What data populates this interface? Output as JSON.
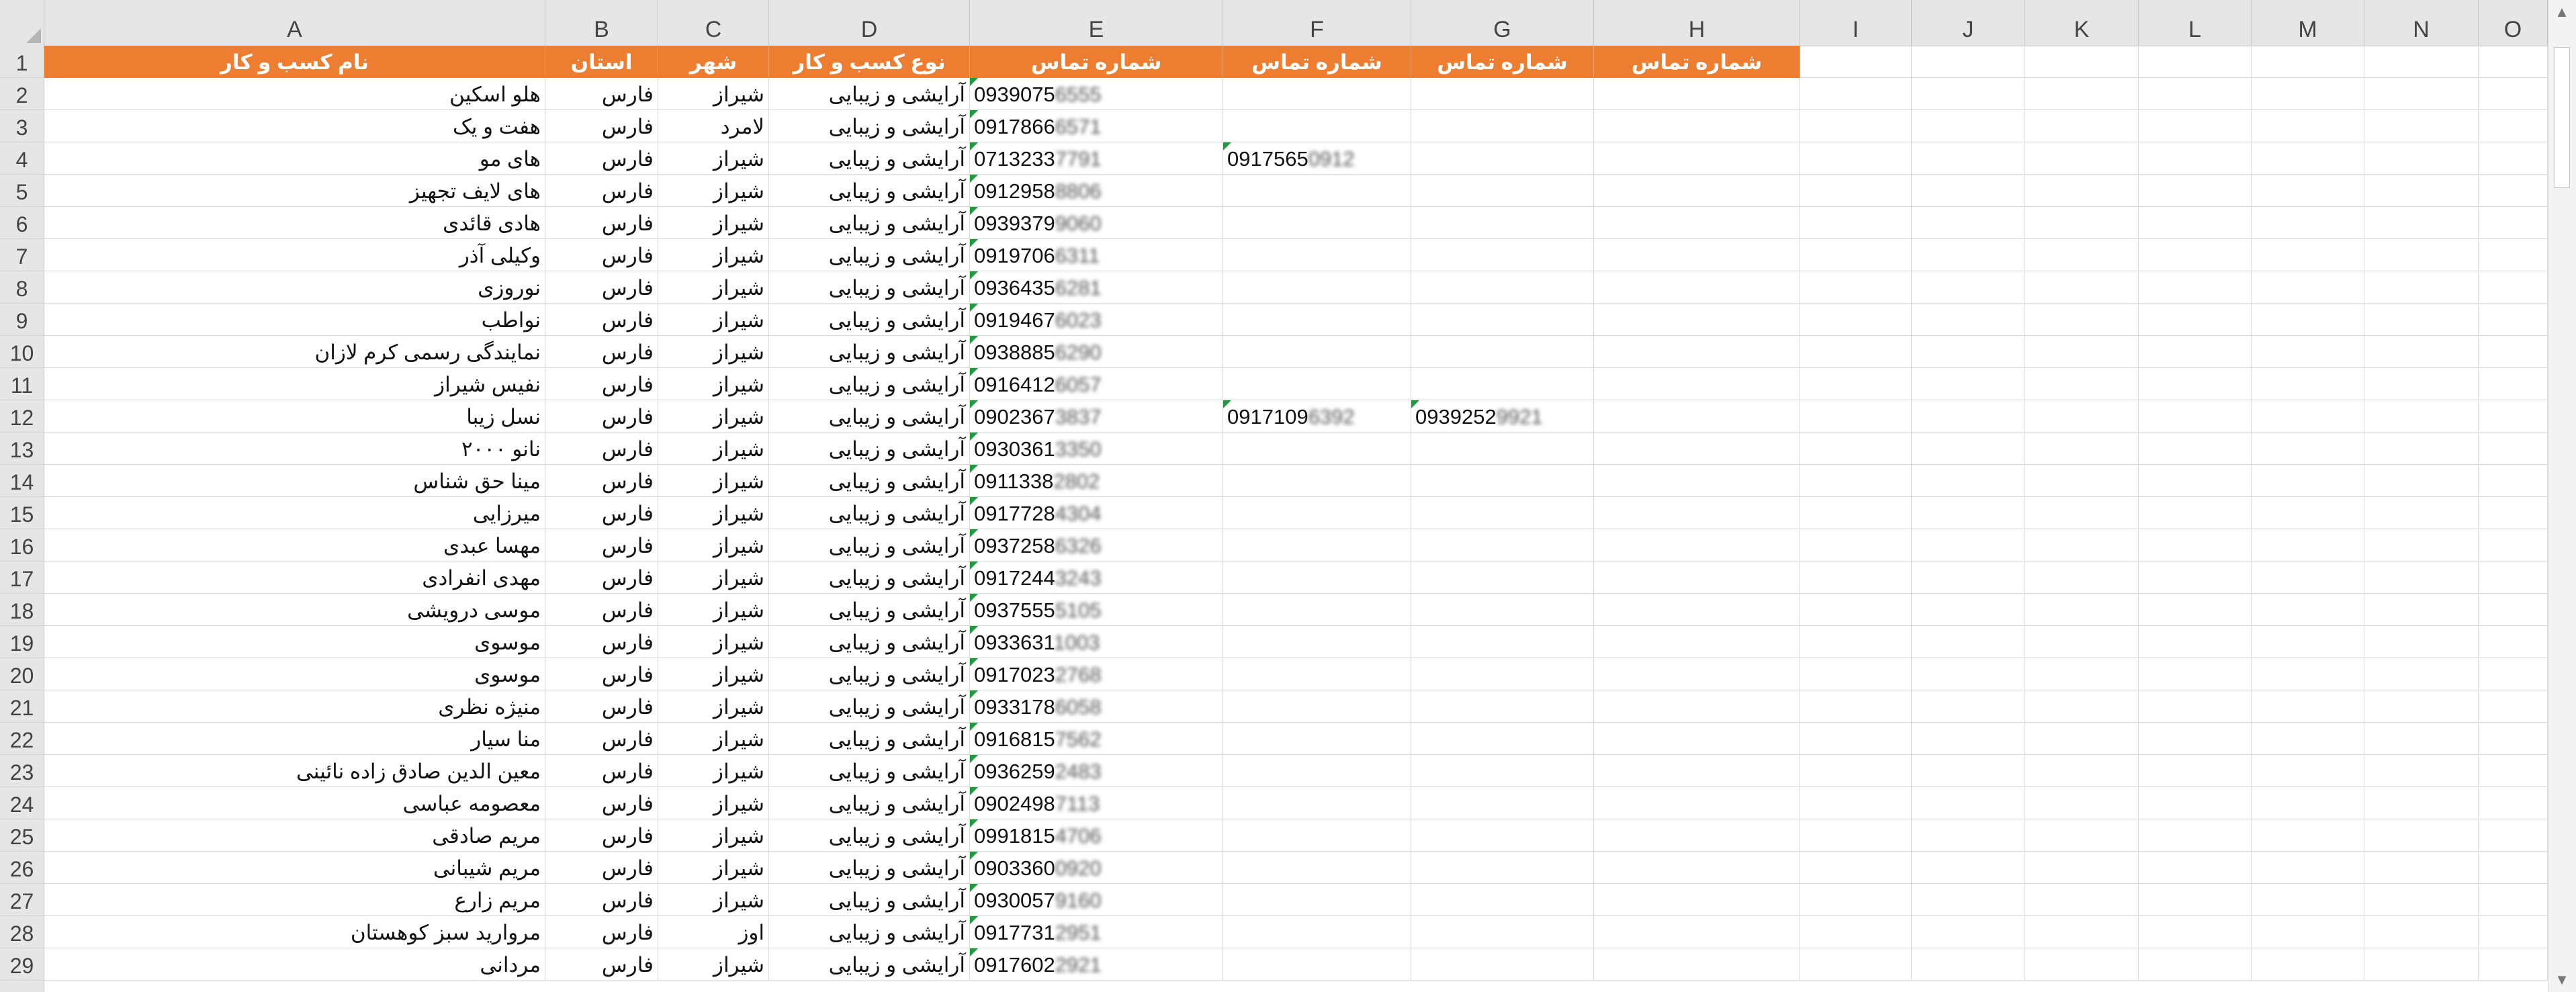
{
  "columns": [
    "A",
    "B",
    "C",
    "D",
    "E",
    "F",
    "G",
    "H",
    "I",
    "J",
    "K",
    "L",
    "M",
    "N",
    "O"
  ],
  "header_row": {
    "row_number": "1",
    "cells": [
      "نام کسب و کار",
      "استان",
      "شهر",
      "نوع کسب و کار",
      "شماره تماس",
      "شماره تماس",
      "شماره تماس",
      "شماره تماس"
    ]
  },
  "rows": [
    {
      "n": "2",
      "name": "هلو اسکین",
      "province": "فارس",
      "city": "شیراز",
      "type": "آرایشی و زیبایی",
      "p1": "0939075",
      "p1b": "6555",
      "p2": "",
      "p2b": "",
      "p3": "",
      "p3b": ""
    },
    {
      "n": "3",
      "name": "هفت و یک",
      "province": "فارس",
      "city": "لامرد",
      "type": "آرایشی و زیبایی",
      "p1": "0917866",
      "p1b": "6571",
      "p2": "",
      "p2b": "",
      "p3": "",
      "p3b": ""
    },
    {
      "n": "4",
      "name": "های مو",
      "province": "فارس",
      "city": "شیراز",
      "type": "آرایشی و زیبایی",
      "p1": "0713233",
      "p1b": "7791",
      "p2": "0917565",
      "p2b": "0912",
      "p3": "",
      "p3b": ""
    },
    {
      "n": "5",
      "name": "های لایف تجهیز",
      "province": "فارس",
      "city": "شیراز",
      "type": "آرایشی و زیبایی",
      "p1": "0912958",
      "p1b": "8806",
      "p2": "",
      "p2b": "",
      "p3": "",
      "p3b": ""
    },
    {
      "n": "6",
      "name": "هادی قائدی",
      "province": "فارس",
      "city": "شیراز",
      "type": "آرایشی و زیبایی",
      "p1": "0939379",
      "p1b": "9060",
      "p2": "",
      "p2b": "",
      "p3": "",
      "p3b": ""
    },
    {
      "n": "7",
      "name": "وکیلی آذر",
      "province": "فارس",
      "city": "شیراز",
      "type": "آرایشی و زیبایی",
      "p1": "0919706",
      "p1b": "6311",
      "p2": "",
      "p2b": "",
      "p3": "",
      "p3b": ""
    },
    {
      "n": "8",
      "name": "نوروزی",
      "province": "فارس",
      "city": "شیراز",
      "type": "آرایشی و زیبایی",
      "p1": "0936435",
      "p1b": "6281",
      "p2": "",
      "p2b": "",
      "p3": "",
      "p3b": ""
    },
    {
      "n": "9",
      "name": "نواطب",
      "province": "فارس",
      "city": "شیراز",
      "type": "آرایشی و زیبایی",
      "p1": "0919467",
      "p1b": "6023",
      "p2": "",
      "p2b": "",
      "p3": "",
      "p3b": ""
    },
    {
      "n": "10",
      "name": "نمایندگی رسمی کرم لازان",
      "province": "فارس",
      "city": "شیراز",
      "type": "آرایشی و زیبایی",
      "p1": "0938885",
      "p1b": "6290",
      "p2": "",
      "p2b": "",
      "p3": "",
      "p3b": ""
    },
    {
      "n": "11",
      "name": "نفیس شیراز",
      "province": "فارس",
      "city": "شیراز",
      "type": "آرایشی و زیبایی",
      "p1": "0916412",
      "p1b": "6057",
      "p2": "",
      "p2b": "",
      "p3": "",
      "p3b": ""
    },
    {
      "n": "12",
      "name": "نسل زیبا",
      "province": "فارس",
      "city": "شیراز",
      "type": "آرایشی و زیبایی",
      "p1": "0902367",
      "p1b": "3837",
      "p2": "0917109",
      "p2b": "6392",
      "p3": "0939252",
      "p3b": "9921"
    },
    {
      "n": "13",
      "name": "نانو ۲۰۰۰",
      "province": "فارس",
      "city": "شیراز",
      "type": "آرایشی و زیبایی",
      "p1": "0930361",
      "p1b": "3350",
      "p2": "",
      "p2b": "",
      "p3": "",
      "p3b": ""
    },
    {
      "n": "14",
      "name": "مینا حق شناس",
      "province": "فارس",
      "city": "شیراز",
      "type": "آرایشی و زیبایی",
      "p1": "0911338",
      "p1b": "2802",
      "p2": "",
      "p2b": "",
      "p3": "",
      "p3b": ""
    },
    {
      "n": "15",
      "name": "میرزایی",
      "province": "فارس",
      "city": "شیراز",
      "type": "آرایشی و زیبایی",
      "p1": "0917728",
      "p1b": "4304",
      "p2": "",
      "p2b": "",
      "p3": "",
      "p3b": ""
    },
    {
      "n": "16",
      "name": "مهسا عبدی",
      "province": "فارس",
      "city": "شیراز",
      "type": "آرایشی و زیبایی",
      "p1": "0937258",
      "p1b": "6326",
      "p2": "",
      "p2b": "",
      "p3": "",
      "p3b": ""
    },
    {
      "n": "17",
      "name": "مهدی انفرادی",
      "province": "فارس",
      "city": "شیراز",
      "type": "آرایشی و زیبایی",
      "p1": "0917244",
      "p1b": "3243",
      "p2": "",
      "p2b": "",
      "p3": "",
      "p3b": ""
    },
    {
      "n": "18",
      "name": "موسی درویشی",
      "province": "فارس",
      "city": "شیراز",
      "type": "آرایشی و زیبایی",
      "p1": "0937555",
      "p1b": "5105",
      "p2": "",
      "p2b": "",
      "p3": "",
      "p3b": ""
    },
    {
      "n": "19",
      "name": "موسوی",
      "province": "فارس",
      "city": "شیراز",
      "type": "آرایشی و زیبایی",
      "p1": "0933631",
      "p1b": "1003",
      "p2": "",
      "p2b": "",
      "p3": "",
      "p3b": ""
    },
    {
      "n": "20",
      "name": "موسوی",
      "province": "فارس",
      "city": "شیراز",
      "type": "آرایشی و زیبایی",
      "p1": "0917023",
      "p1b": "2768",
      "p2": "",
      "p2b": "",
      "p3": "",
      "p3b": ""
    },
    {
      "n": "21",
      "name": "منیژه نظری",
      "province": "فارس",
      "city": "شیراز",
      "type": "آرایشی و زیبایی",
      "p1": "0933178",
      "p1b": "6058",
      "p2": "",
      "p2b": "",
      "p3": "",
      "p3b": ""
    },
    {
      "n": "22",
      "name": "منا سیار",
      "province": "فارس",
      "city": "شیراز",
      "type": "آرایشی و زیبایی",
      "p1": "0916815",
      "p1b": "7562",
      "p2": "",
      "p2b": "",
      "p3": "",
      "p3b": ""
    },
    {
      "n": "23",
      "name": "معین الدین صادق زاده نائینی",
      "province": "فارس",
      "city": "شیراز",
      "type": "آرایشی و زیبایی",
      "p1": "0936259",
      "p1b": "2483",
      "p2": "",
      "p2b": "",
      "p3": "",
      "p3b": ""
    },
    {
      "n": "24",
      "name": "معصومه عباسی",
      "province": "فارس",
      "city": "شیراز",
      "type": "آرایشی و زیبایی",
      "p1": "0902498",
      "p1b": "7113",
      "p2": "",
      "p2b": "",
      "p3": "",
      "p3b": ""
    },
    {
      "n": "25",
      "name": "مریم صادقی",
      "province": "فارس",
      "city": "شیراز",
      "type": "آرایشی و زیبایی",
      "p1": "0991815",
      "p1b": "4706",
      "p2": "",
      "p2b": "",
      "p3": "",
      "p3b": ""
    },
    {
      "n": "26",
      "name": "مریم شیبانی",
      "province": "فارس",
      "city": "شیراز",
      "type": "آرایشی و زیبایی",
      "p1": "0903360",
      "p1b": "0920",
      "p2": "",
      "p2b": "",
      "p3": "",
      "p3b": ""
    },
    {
      "n": "27",
      "name": "مریم زارع",
      "province": "فارس",
      "city": "شیراز",
      "type": "آرایشی و زیبایی",
      "p1": "0930057",
      "p1b": "9160",
      "p2": "",
      "p2b": "",
      "p3": "",
      "p3b": ""
    },
    {
      "n": "28",
      "name": "مروارید سبز کوهستان",
      "province": "فارس",
      "city": "اوز",
      "type": "آرایشی و زیبایی",
      "p1": "0917731",
      "p1b": "2951",
      "p2": "",
      "p2b": "",
      "p3": "",
      "p3b": ""
    },
    {
      "n": "29",
      "name": "مردانی",
      "province": "فارس",
      "city": "شیراز",
      "type": "آرایشی و زیبایی",
      "p1": "0917602",
      "p1b": "2921",
      "p2": "",
      "p2b": "",
      "p3": "",
      "p3b": ""
    }
  ],
  "colors": {
    "header_fill": "#ed7d31",
    "header_text": "#ffffff",
    "comment_triangle": "#1e9b3c"
  },
  "scrollbar": {
    "up_icon": "chevron-up-icon",
    "down_icon": "chevron-down-icon"
  }
}
